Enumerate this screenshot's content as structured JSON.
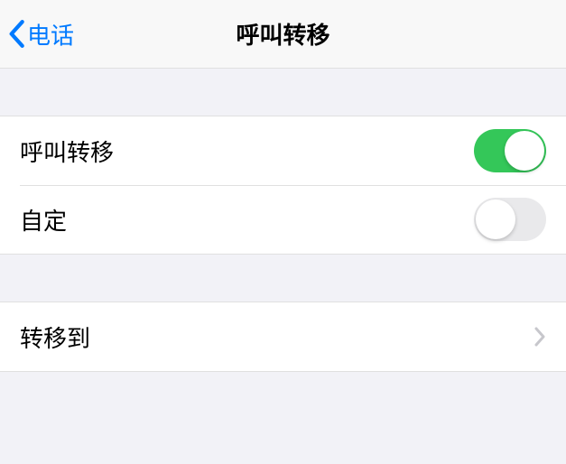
{
  "nav": {
    "back_label": "电话",
    "title": "呼叫转移"
  },
  "rows": {
    "call_forward": {
      "label": "呼叫转移",
      "enabled": true
    },
    "custom": {
      "label": "自定",
      "enabled": false
    },
    "forward_to": {
      "label": "转移到",
      "value": ""
    }
  }
}
